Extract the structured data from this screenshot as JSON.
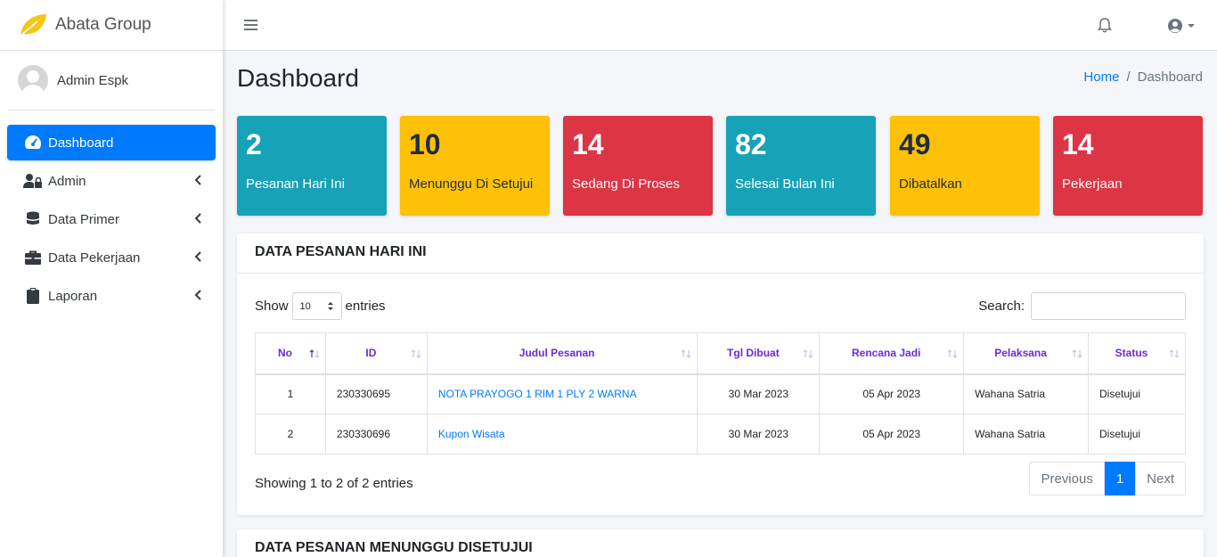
{
  "brand": {
    "name": "Abata Group"
  },
  "user": {
    "name": "Admin Espk"
  },
  "sidebar": {
    "items": [
      {
        "label": "Dashboard",
        "icon": "tachometer-icon",
        "active": true
      },
      {
        "label": "Admin",
        "icon": "user-lock-icon"
      },
      {
        "label": "Data Primer",
        "icon": "database-icon"
      },
      {
        "label": "Data Pekerjaan",
        "icon": "briefcase-icon"
      },
      {
        "label": "Laporan",
        "icon": "clipboard-icon"
      }
    ]
  },
  "header": {
    "title": "Dashboard",
    "breadcrumb": {
      "home": "Home",
      "separator": "/",
      "current": "Dashboard"
    }
  },
  "stats": [
    {
      "value": "2",
      "label": "Pesanan Hari Ini",
      "color": "#17a2b8"
    },
    {
      "value": "10",
      "label": "Menunggu Di Setujui",
      "color": "#ffc107"
    },
    {
      "value": "14",
      "label": "Sedang Di Proses",
      "color": "#dc3545"
    },
    {
      "value": "82",
      "label": "Selesai Bulan Ini",
      "color": "#17a2b8"
    },
    {
      "value": "49",
      "label": "Dibatalkan",
      "color": "#ffc107"
    },
    {
      "value": "14",
      "label": "Pekerjaan",
      "color": "#dc3545"
    }
  ],
  "table_card": {
    "title": "DATA PESANAN HARI INI",
    "show_label": "Show",
    "entries_label": "entries",
    "length_value": "10",
    "search_label": "Search:",
    "search_value": "",
    "columns": [
      "No",
      "ID",
      "Judul Pesanan",
      "Tgl Dibuat",
      "Rencana Jadi",
      "Pelaksana",
      "Status"
    ],
    "rows": [
      [
        "1",
        "230330695",
        "NOTA PRAYOGO 1 RIM 1 PLY 2 WARNA",
        "30 Mar 2023",
        "05 Apr 2023",
        "Wahana Satria",
        "Disetujui"
      ],
      [
        "2",
        "230330696",
        "Kupon Wisata",
        "30 Mar 2023",
        "05 Apr 2023",
        "Wahana Satria",
        "Disetujui"
      ]
    ],
    "info": "Showing 1 to 2 of 2 entries",
    "pagination": {
      "previous": "Previous",
      "page": "1",
      "next": "Next"
    }
  },
  "second_card": {
    "title": "DATA PESANAN MENUNGGU DISETUJUI"
  },
  "colors": {
    "primary": "#007bff",
    "info": "#17a2b8",
    "warning": "#ffc107",
    "danger": "#dc3545",
    "header_text": "#6a2bd9"
  }
}
